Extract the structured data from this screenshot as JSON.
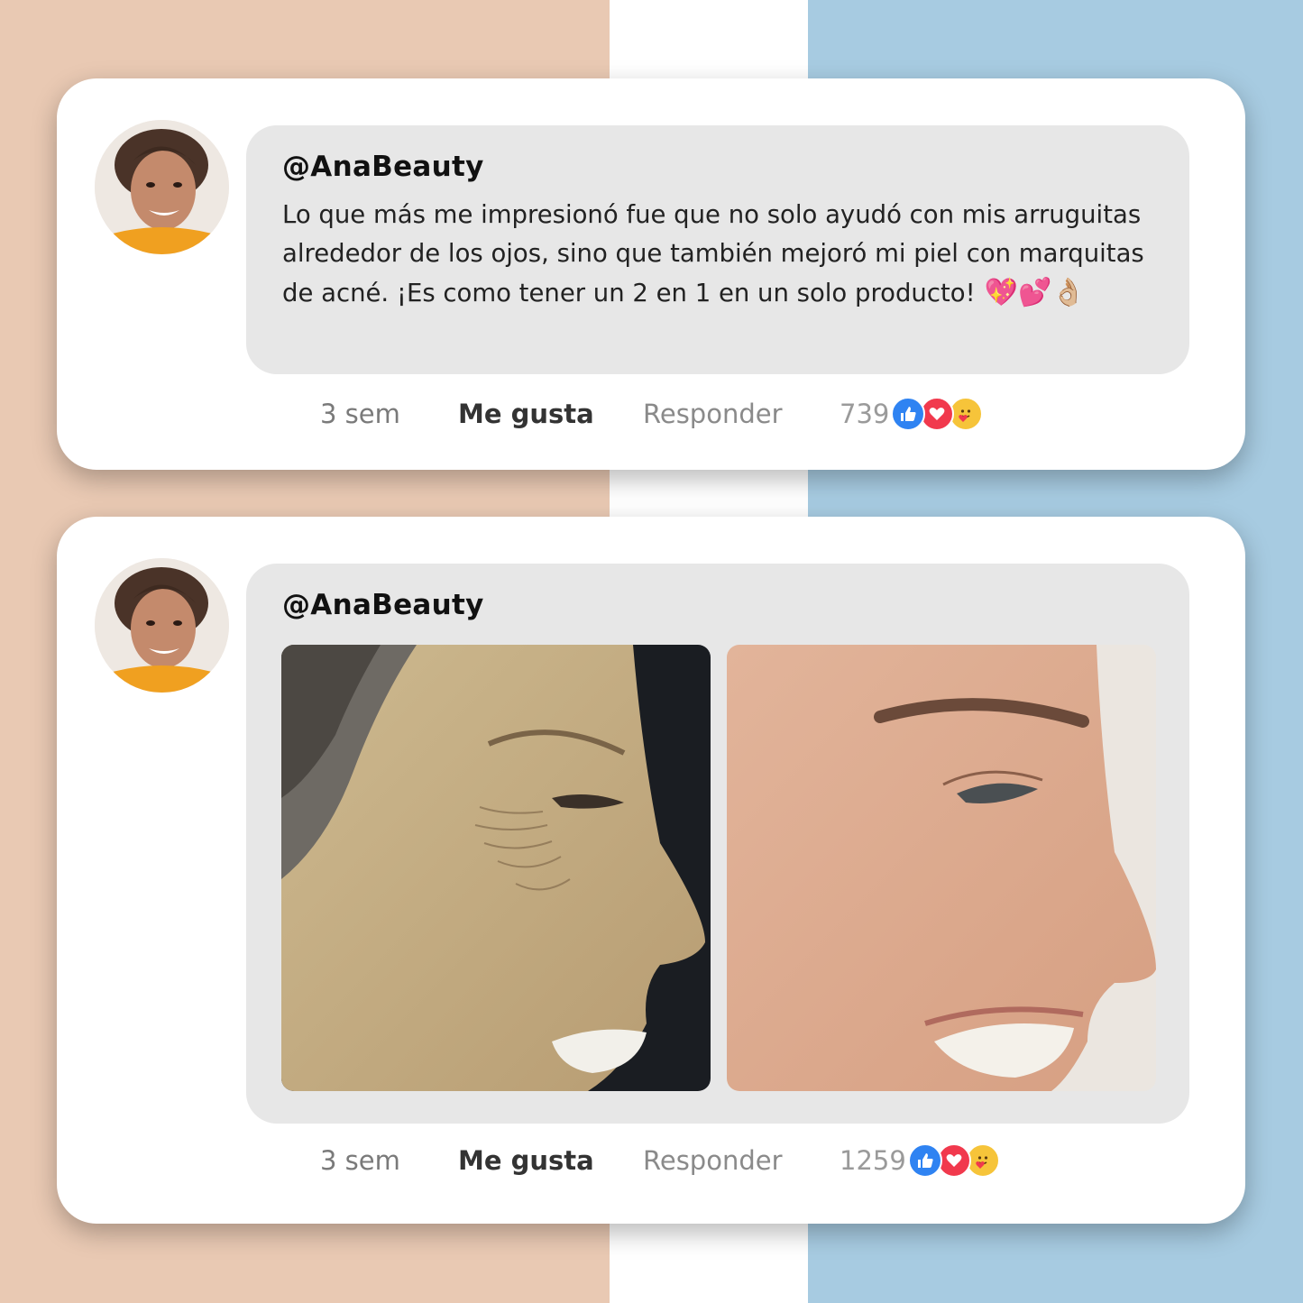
{
  "posts": [
    {
      "username": "@AnaBeauty",
      "comment": "Lo que más me impresionó fue que no solo ayudó con mis arruguitas alrededor de los ojos, sino que también mejoró mi piel con marquitas de acné. ¡Es como tener un 2 en 1 en un solo producto!",
      "emojis": "💖💕👌🏼",
      "time": "3 sem",
      "like_label": "Me gusta",
      "reply_label": "Responder",
      "reaction_count": "739",
      "reactions": [
        "like-icon",
        "love-icon",
        "care-icon"
      ]
    },
    {
      "username": "@AnaBeauty",
      "photos": [
        "before-photo",
        "after-photo"
      ],
      "time": "3 sem",
      "like_label": "Me gusta",
      "reply_label": "Responder",
      "reaction_count": "1259",
      "reactions": [
        "like-icon",
        "love-icon",
        "care-icon"
      ]
    }
  ],
  "colors": {
    "left_panel": "#e9c9b3",
    "right_panel": "#a7cbe1",
    "like_blue": "#2f83f2",
    "love_red": "#f1394d",
    "care_yellow": "#f6c43a"
  }
}
